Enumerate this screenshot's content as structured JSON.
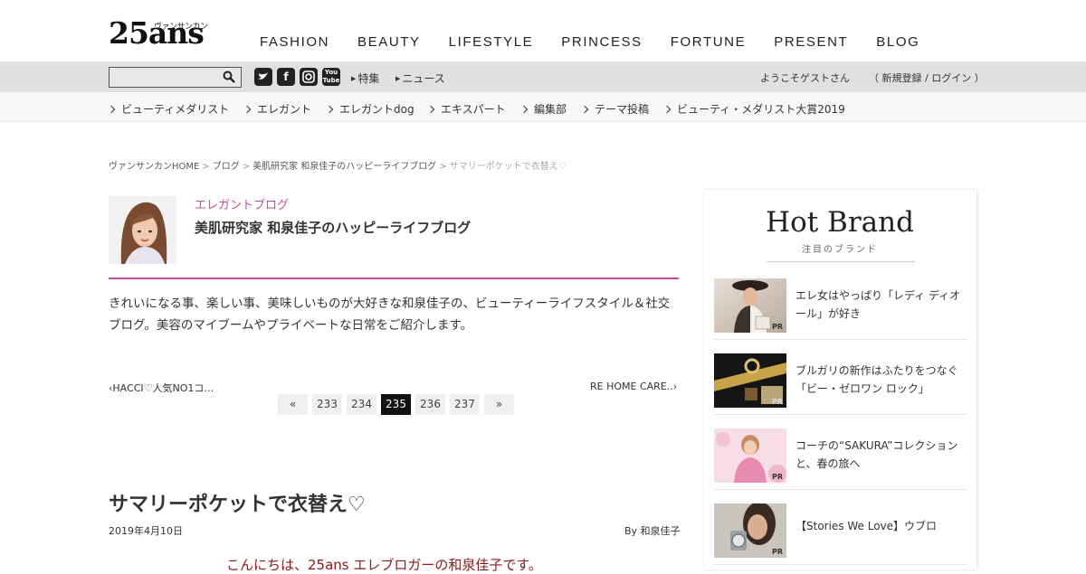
{
  "header": {
    "logo_main": "25ans",
    "logo_kana": "ヴァンサンカン",
    "nav": [
      "FASHION",
      "BEAUTY",
      "LIFESTYLE",
      "PRINCESS",
      "FORTUNE",
      "PRESENT",
      "BLOG"
    ]
  },
  "util_bar": {
    "search_placeholder": "",
    "social": [
      "twitter",
      "facebook",
      "instagram",
      "youtube"
    ],
    "links": [
      "特集",
      "ニュース"
    ],
    "welcome": "ようこそゲストさん",
    "login": "（ 新規登録 / ログイン ）"
  },
  "sub_nav": [
    "ビューティメダリスト",
    "エレガント",
    "エレガントdog",
    "エキスパート",
    "編集部",
    "テーマ投稿",
    "ビューティ・メダリスト大賞2019"
  ],
  "breadcrumb": [
    "ヴァンサンカンHOME",
    "ブログ",
    "美肌研究家 和泉佳子のハッピーライフブログ",
    "サマリーポケットで衣替え♡"
  ],
  "blog": {
    "category": "エレガントブログ",
    "title": "美肌研究家 和泉佳子のハッピーライフブログ",
    "description": "きれいになる事、楽しい事、美味しいものが大好きな和泉佳子の、ビューティーライフスタイル＆社交ブログ。美容のマイブームやプライベートな日常をご紹介します。"
  },
  "post_nav": {
    "prev": "HACCI♡人気NO1コ…",
    "next": "RE HOME CARE..",
    "pages": [
      "«",
      "233",
      "234",
      "235",
      "236",
      "237",
      "»"
    ],
    "active_page": "235"
  },
  "post": {
    "title": "サマリーポケットで衣替え♡",
    "date": "2019年4月10日",
    "author": "By 和泉佳子",
    "greeting": "こんにちは、25ans エレブロガーの和泉佳子です。"
  },
  "sidebar": {
    "title": "Hot Brand",
    "subtitle": "注目のブランド",
    "pr_label": "PR",
    "items": [
      {
        "text": "エレ女はやっぱり「レディ ディオール」が好き"
      },
      {
        "text": "ブルガリの新作はふたりをつなぐ「ビー・ゼロワン ロック」"
      },
      {
        "text": "コーチの“SAKURA”コレクションと、春の旅へ"
      },
      {
        "text": "【Stories We Love】ウブロ"
      }
    ]
  }
}
